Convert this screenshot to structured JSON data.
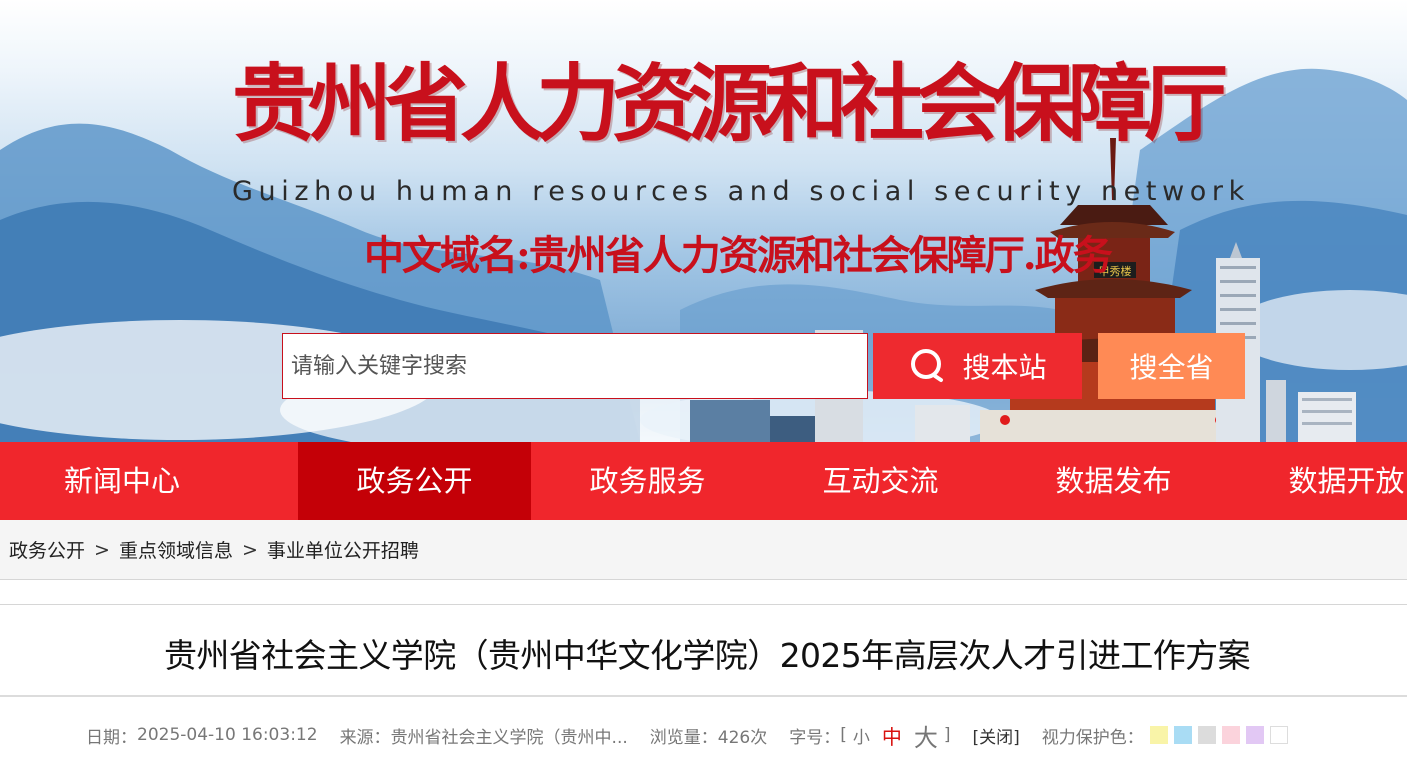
{
  "header": {
    "title": "贵州省人力资源和社会保障厅",
    "subtitle": "Guizhou human resources and social security network",
    "domain": "中文域名:贵州省人力资源和社会保障厅.政务",
    "pavilion_plaque": "甲秀楼"
  },
  "search": {
    "placeholder": "请输入关键字搜索",
    "value": "",
    "site_button": "搜本站",
    "province_button": "搜全省"
  },
  "nav": {
    "items": [
      {
        "label": "新闻中心"
      },
      {
        "label": "政务公开"
      },
      {
        "label": "政务服务"
      },
      {
        "label": "互动交流"
      },
      {
        "label": "数据发布"
      },
      {
        "label": "数据开放"
      }
    ],
    "active_index": 1
  },
  "breadcrumb": {
    "items": [
      "政务公开",
      "重点领域信息",
      "事业单位公开招聘"
    ],
    "separator": ">"
  },
  "article": {
    "title": "贵州省社会主义学院（贵州中华文化学院）2025年高层次人才引进工作方案",
    "meta": {
      "date_label": "日期：",
      "date": "2025-04-10 16:03:12",
      "source_label": "来源：",
      "source": "贵州省社会主义学院（贵州中...",
      "views_label": "浏览量：",
      "views": "426次",
      "fontsize_label": "字号：",
      "bracket_open": "[",
      "bracket_close": "]",
      "font_small": "小",
      "font_medium": "中",
      "font_large": "大",
      "close": "[关闭]",
      "eye_label": "视力保护色："
    }
  },
  "eye_colors": [
    "#f9f4a8",
    "#a9dcf4",
    "#dcdcdc",
    "#fbd3dc",
    "#e2c8f4",
    "#ffffff"
  ],
  "colors": {
    "brand_red": "#f0262c",
    "active_red": "#c40007",
    "title_red": "#c8101c",
    "search_orange": "#ff8a55"
  }
}
